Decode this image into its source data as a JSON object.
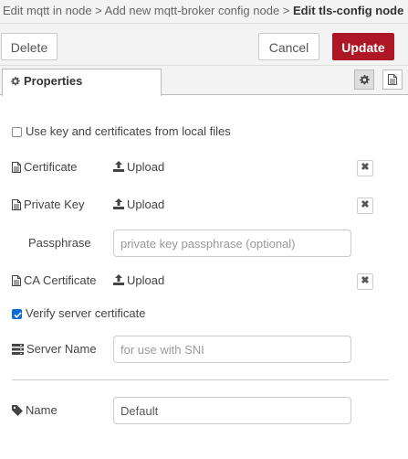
{
  "breadcrumb": {
    "crumb1": "Edit mqtt in node",
    "sep1": " > ",
    "crumb2": "Add new mqtt-broker config node",
    "sep2": " > ",
    "current": "Edit tls-config node"
  },
  "toolbar": {
    "delete_label": "Delete",
    "cancel_label": "Cancel",
    "update_label": "Update"
  },
  "tabs": {
    "properties_label": "Properties"
  },
  "form": {
    "local_files_label": "Use key and certificates from local files",
    "local_files_checked": false,
    "certificate_label": "Certificate",
    "certificate_upload": "Upload",
    "private_key_label": "Private Key",
    "private_key_upload": "Upload",
    "passphrase_label": "Passphrase",
    "passphrase_placeholder": "private key passphrase (optional)",
    "passphrase_value": "",
    "ca_label": "CA Certificate",
    "ca_upload": "Upload",
    "verify_label": "Verify server certificate",
    "verify_checked": true,
    "server_name_label": "Server Name",
    "server_name_placeholder": "for use with SNI",
    "server_name_value": "",
    "name_label": "Name",
    "name_value": "Default"
  },
  "colors": {
    "update_button": "#ad1625",
    "checkbox_on": "#0a6bd8"
  }
}
